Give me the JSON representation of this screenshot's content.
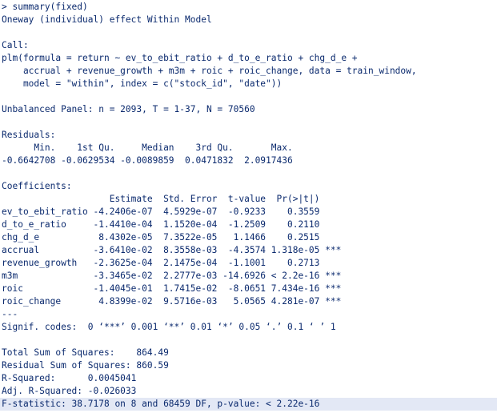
{
  "console": {
    "lines": [
      "> summary(fixed)",
      "Oneway (individual) effect Within Model",
      "",
      "Call:",
      "plm(formula = return ~ ev_to_ebit_ratio + d_to_e_ratio + chg_d_e +",
      "    accrual + revenue_growth + m3m + roic + roic_change, data = train_window,",
      "    model = \"within\", index = c(\"stock_id\", \"date\"))",
      "",
      "Unbalanced Panel: n = 2093, T = 1-37, N = 70560",
      "",
      "Residuals:",
      "      Min.    1st Qu.     Median    3rd Qu.       Max.",
      "-0.6642708 -0.0629534 -0.0089859  0.0471832  2.0917436",
      "",
      "Coefficients:",
      "                    Estimate  Std. Error  t-value  Pr(>|t|)",
      "ev_to_ebit_ratio -4.2406e-07  4.5929e-07  -0.9233    0.3559",
      "d_to_e_ratio     -1.4410e-04  1.1520e-04  -1.2509    0.2110",
      "chg_d_e           8.4302e-05  7.3522e-05   1.1466    0.2515",
      "accrual          -3.6410e-02  8.3558e-03  -4.3574 1.318e-05 ***",
      "revenue_growth   -2.3625e-04  2.1475e-04  -1.1001    0.2713",
      "m3m              -3.3465e-02  2.2777e-03 -14.6926 < 2.2e-16 ***",
      "roic             -1.4045e-01  1.7415e-02  -8.0651 7.434e-16 ***",
      "roic_change       4.8399e-02  9.5716e-03   5.0565 4.281e-07 ***",
      "---",
      "Signif. codes:  0 ‘***’ 0.001 ‘**’ 0.01 ‘*’ 0.05 ‘.’ 0.1 ‘ ’ 1",
      "",
      "Total Sum of Squares:    864.49",
      "Residual Sum of Squares: 860.59",
      "R-Squared:      0.0045041",
      "Adj. R-Squared: -0.026033",
      "F-statistic: 38.7178 on 8 and 68459 DF, p-value: < 2.22e-16"
    ]
  }
}
